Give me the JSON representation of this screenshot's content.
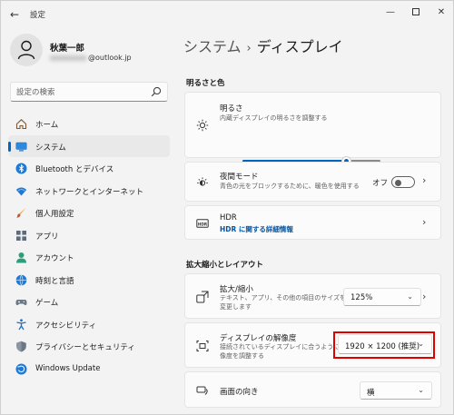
{
  "titlebar": {
    "title": "設定",
    "back_glyph": "←",
    "min_glyph": "—",
    "close_glyph": "✕"
  },
  "profile": {
    "name": "秋葉一郎",
    "email_visible": "@outlook.jp"
  },
  "search": {
    "placeholder": "設定の検索"
  },
  "sidebar": {
    "items": [
      {
        "label": "ホーム",
        "icon": "home-icon"
      },
      {
        "label": "システム",
        "icon": "system-monitor-icon",
        "selected": true
      },
      {
        "label": "Bluetooth とデバイス",
        "icon": "bluetooth-icon"
      },
      {
        "label": "ネットワークとインターネット",
        "icon": "wifi-icon"
      },
      {
        "label": "個人用設定",
        "icon": "brush-icon"
      },
      {
        "label": "アプリ",
        "icon": "apps-icon"
      },
      {
        "label": "アカウント",
        "icon": "account-icon"
      },
      {
        "label": "時刻と言語",
        "icon": "time-language-icon"
      },
      {
        "label": "ゲーム",
        "icon": "gamepad-icon"
      },
      {
        "label": "アクセシビリティ",
        "icon": "accessibility-icon"
      },
      {
        "label": "プライバシーとセキュリティ",
        "icon": "shield-icon"
      },
      {
        "label": "Windows Update",
        "icon": "windows-update-icon"
      }
    ]
  },
  "breadcrumb": {
    "parent": "システム",
    "separator": "›",
    "current": "ディスプレイ"
  },
  "sections": {
    "brightness_color": "明るさと色",
    "scale_layout": "拡大縮小とレイアウト"
  },
  "brightness": {
    "title": "明るさ",
    "desc": "内蔵ディスプレイの明るさを調整する",
    "level_fraction": 0.75
  },
  "night_light": {
    "title": "夜間モード",
    "desc": "青色の光をブロックするために、暖色を使用する",
    "toggle_label": "オフ",
    "on": false
  },
  "hdr": {
    "title": "HDR",
    "link": "HDR に関する詳細情報"
  },
  "scale": {
    "title": "拡大/縮小",
    "desc": "テキスト、アプリ、その他の項目のサイズを変更します",
    "value": "125%"
  },
  "resolution": {
    "title": "ディスプレイの解像度",
    "desc": "接続されているディスプレイに合うように解像度を調整する",
    "value": "1920 × 1200 (推奨)"
  },
  "orientation": {
    "title": "画面の向き",
    "value": "横"
  },
  "colors": {
    "accent": "#0067c0",
    "highlight": "#e00000"
  }
}
